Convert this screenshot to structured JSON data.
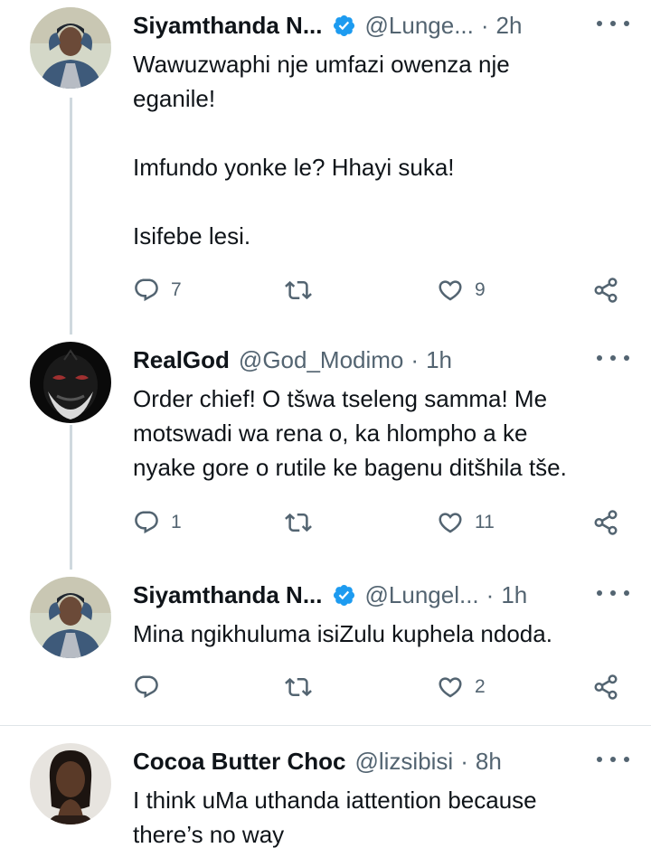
{
  "tweets": [
    {
      "name": "Siyamthanda N...",
      "handle": "@Lunge...",
      "time": "2h",
      "verified": true,
      "text": "Wawuzwaphi nje umfazi owenza nje\neganile!\n\nImfundo yonke le? Hhayi suka!\n\nIsifebe lesi.",
      "replies": "7",
      "retweets": "",
      "likes": "9"
    },
    {
      "name": "RealGod",
      "handle": "@God_Modimo",
      "time": "1h",
      "verified": false,
      "text": "Order chief! O tšwa tseleng samma! Me\nmotswadi wa rena o, ka hlompho a ke\nnyake gore o rutile ke bagenu ditšhila tše.",
      "replies": "1",
      "retweets": "",
      "likes": "11"
    },
    {
      "name": "Siyamthanda N...",
      "handle": "@Lungel...",
      "time": "1h",
      "verified": true,
      "text": "Mina ngikhuluma isiZulu kuphela ndoda.",
      "replies": "",
      "retweets": "",
      "likes": "2"
    },
    {
      "name": "Cocoa Butter Choc",
      "handle": "@lizsibisi",
      "time": "8h",
      "verified": false,
      "text": "I think uMa uthanda iattention because\nthere’s no way",
      "replies": "",
      "retweets": "",
      "likes": ""
    }
  ],
  "separator": "·",
  "colors": {
    "verified_badge": "#1d9bf0",
    "secondary_text": "#536471",
    "thread_line": "#cfd9de"
  },
  "icons": [
    "reply-icon",
    "retweet-icon",
    "like-icon",
    "share-icon",
    "more-icon",
    "verified-badge-icon"
  ]
}
